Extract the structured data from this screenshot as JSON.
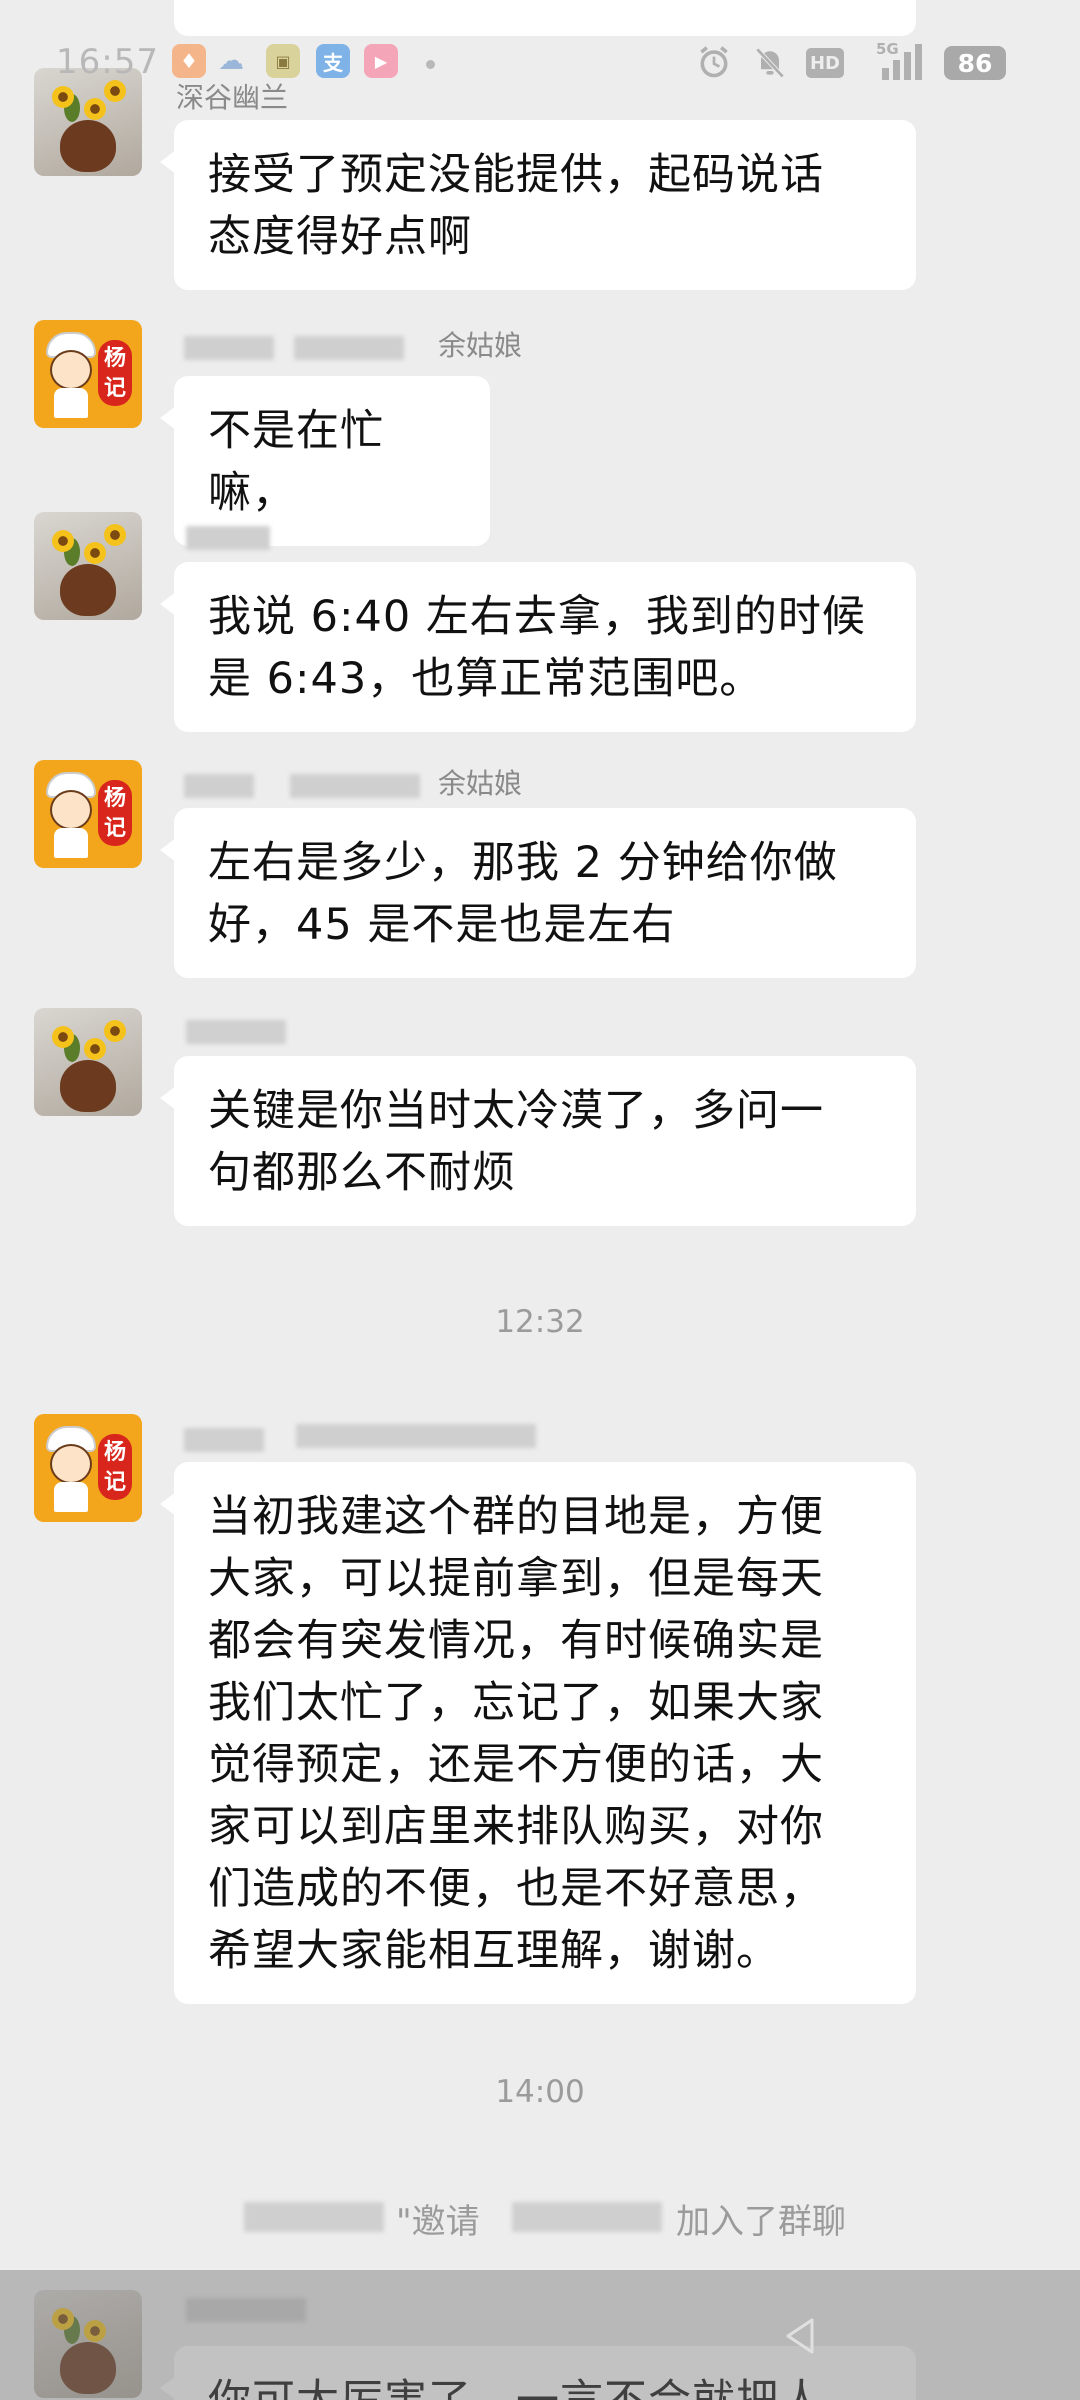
{
  "status_bar": {
    "time": "16:57",
    "app_icons": [
      "notification-app-icon",
      "cloud-app-icon",
      "photo-app-icon",
      "alipay-icon",
      "video-app-icon"
    ],
    "alipay_label": "支",
    "hd_label": "HD",
    "network_label": "5G",
    "battery": "86"
  },
  "messages": [
    {
      "sender": "深谷幽兰",
      "avatar": "flower-vase",
      "text_lines": [
        "接受了预定没能提供，起码说话",
        "态度得好点啊"
      ]
    },
    {
      "sender": "余姑娘",
      "avatar": "yangji-brand",
      "text_lines": [
        "不是在忙嘛，"
      ]
    },
    {
      "sender": "",
      "avatar": "flower-vase",
      "text_lines": [
        "我说 6:40 左右去拿，我到的时候",
        "是 6:43，也算正常范围吧。"
      ]
    },
    {
      "sender": "余姑娘",
      "avatar": "yangji-brand",
      "text_lines": [
        "左右是多少，那我 2 分钟给你做",
        "好，45 是不是也是左右"
      ]
    },
    {
      "sender": "",
      "avatar": "flower-vase",
      "text_lines": [
        "关键是你当时太冷漠了，多问一",
        "句都那么不耐烦"
      ]
    },
    {
      "sender": "",
      "avatar": "yangji-brand",
      "text_lines": [
        "当初我建这个群的目地是，方便",
        "大家，可以提前拿到，但是每天",
        "都会有突发情况，有时候确实是",
        "我们太忙了，忘记了，如果大家",
        "觉得预定，还是不方便的话，大",
        "家可以到店里来排队购买，对你",
        "们造成的不便，也是不好意思，",
        "希望大家能相互理解，谢谢。"
      ]
    },
    {
      "sender": "",
      "avatar": "flower-vase",
      "text_lines": [
        "你可太厉害了，一言不合就把人"
      ]
    }
  ],
  "time_dividers": [
    "12:32",
    "14:00"
  ],
  "system_notice": {
    "prefix": "\"邀请",
    "suffix": "加入了群聊"
  },
  "brand_badge_text": [
    "杨",
    "记"
  ]
}
